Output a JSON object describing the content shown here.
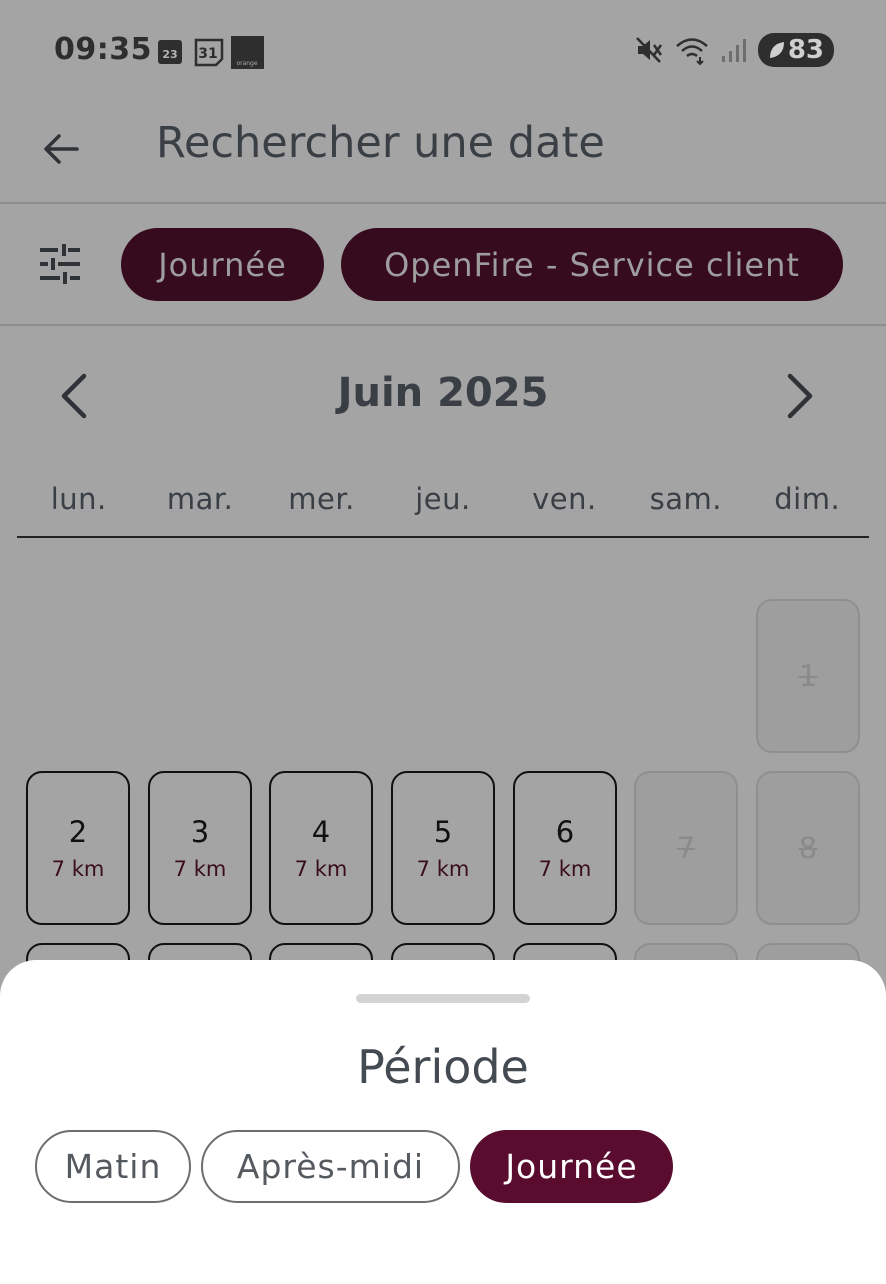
{
  "status_bar": {
    "time": "09:35",
    "calendar_icon_day": "23",
    "calendar2_icon_day": "31",
    "carrier_icon_label": "orange",
    "battery_level": "83",
    "icons": [
      "calendar-icon",
      "calendar-31-icon",
      "orange-icon",
      "mute-icon",
      "wifi-icon",
      "signal-icon",
      "battery-icon"
    ]
  },
  "app_bar": {
    "back_icon": "arrow-left-icon",
    "title": "Rechercher une date"
  },
  "filters": {
    "filter_icon": "tune-icon",
    "chips": [
      {
        "label": "Journée"
      },
      {
        "label": "OpenFire - Service client"
      }
    ]
  },
  "calendar": {
    "month_label": "Juin 2025",
    "prev_icon": "chevron-left-icon",
    "next_icon": "chevron-right-icon",
    "weekdays": [
      "lun.",
      "mar.",
      "mer.",
      "jeu.",
      "ven.",
      "sam.",
      "dim."
    ],
    "days": [
      {
        "day": "1",
        "available": false,
        "distance": ""
      },
      {
        "day": "2",
        "available": true,
        "distance": "7 km"
      },
      {
        "day": "3",
        "available": true,
        "distance": "7 km"
      },
      {
        "day": "4",
        "available": true,
        "distance": "7 km"
      },
      {
        "day": "5",
        "available": true,
        "distance": "7 km"
      },
      {
        "day": "6",
        "available": true,
        "distance": "7 km"
      },
      {
        "day": "7",
        "available": false,
        "distance": ""
      },
      {
        "day": "8",
        "available": false,
        "distance": ""
      }
    ]
  },
  "period_sheet": {
    "title": "Période",
    "options": [
      {
        "label": "Matin",
        "selected": false
      },
      {
        "label": "Après-midi",
        "selected": false
      },
      {
        "label": "Journée",
        "selected": true
      }
    ]
  },
  "colors": {
    "accent": "#5a0c2e",
    "chip_dark_dimmed": "#370b1e",
    "scrim_background": "#a4a4a4"
  }
}
